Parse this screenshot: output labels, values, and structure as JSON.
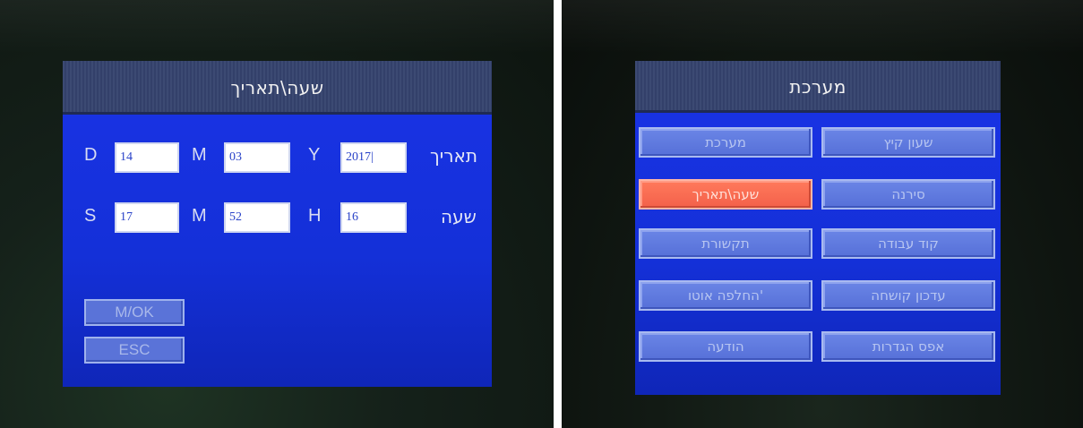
{
  "left_screen": {
    "title": "שעה\\תאריך",
    "date_row": {
      "label": "תאריך",
      "day_label": "D",
      "day_value": "14",
      "month_label": "M",
      "month_value": "03",
      "year_label": "Y",
      "year_value": "2017|"
    },
    "time_row": {
      "label": "שעה",
      "sec_label": "S",
      "sec_value": "17",
      "min_label": "M",
      "min_value": "52",
      "hour_label": "H",
      "hour_value": "16"
    },
    "buttons": {
      "ok": "M/OK",
      "esc": "ESC"
    }
  },
  "right_screen": {
    "title": "מערכת",
    "menu": [
      [
        "שעון קיץ",
        "מערכת"
      ],
      [
        "סירנה",
        "שעה\\תאריך"
      ],
      [
        "קוד עבודה",
        "תקשורת"
      ],
      [
        "עדכון קושחה",
        "החלפה אוטו'"
      ],
      [
        "אפס הגדרות",
        "הודעה"
      ]
    ],
    "selected_item": "שעה\\תאריך"
  },
  "colors": {
    "screen_blue": "#1a33e6",
    "selected_highlight": "#f3604a"
  }
}
